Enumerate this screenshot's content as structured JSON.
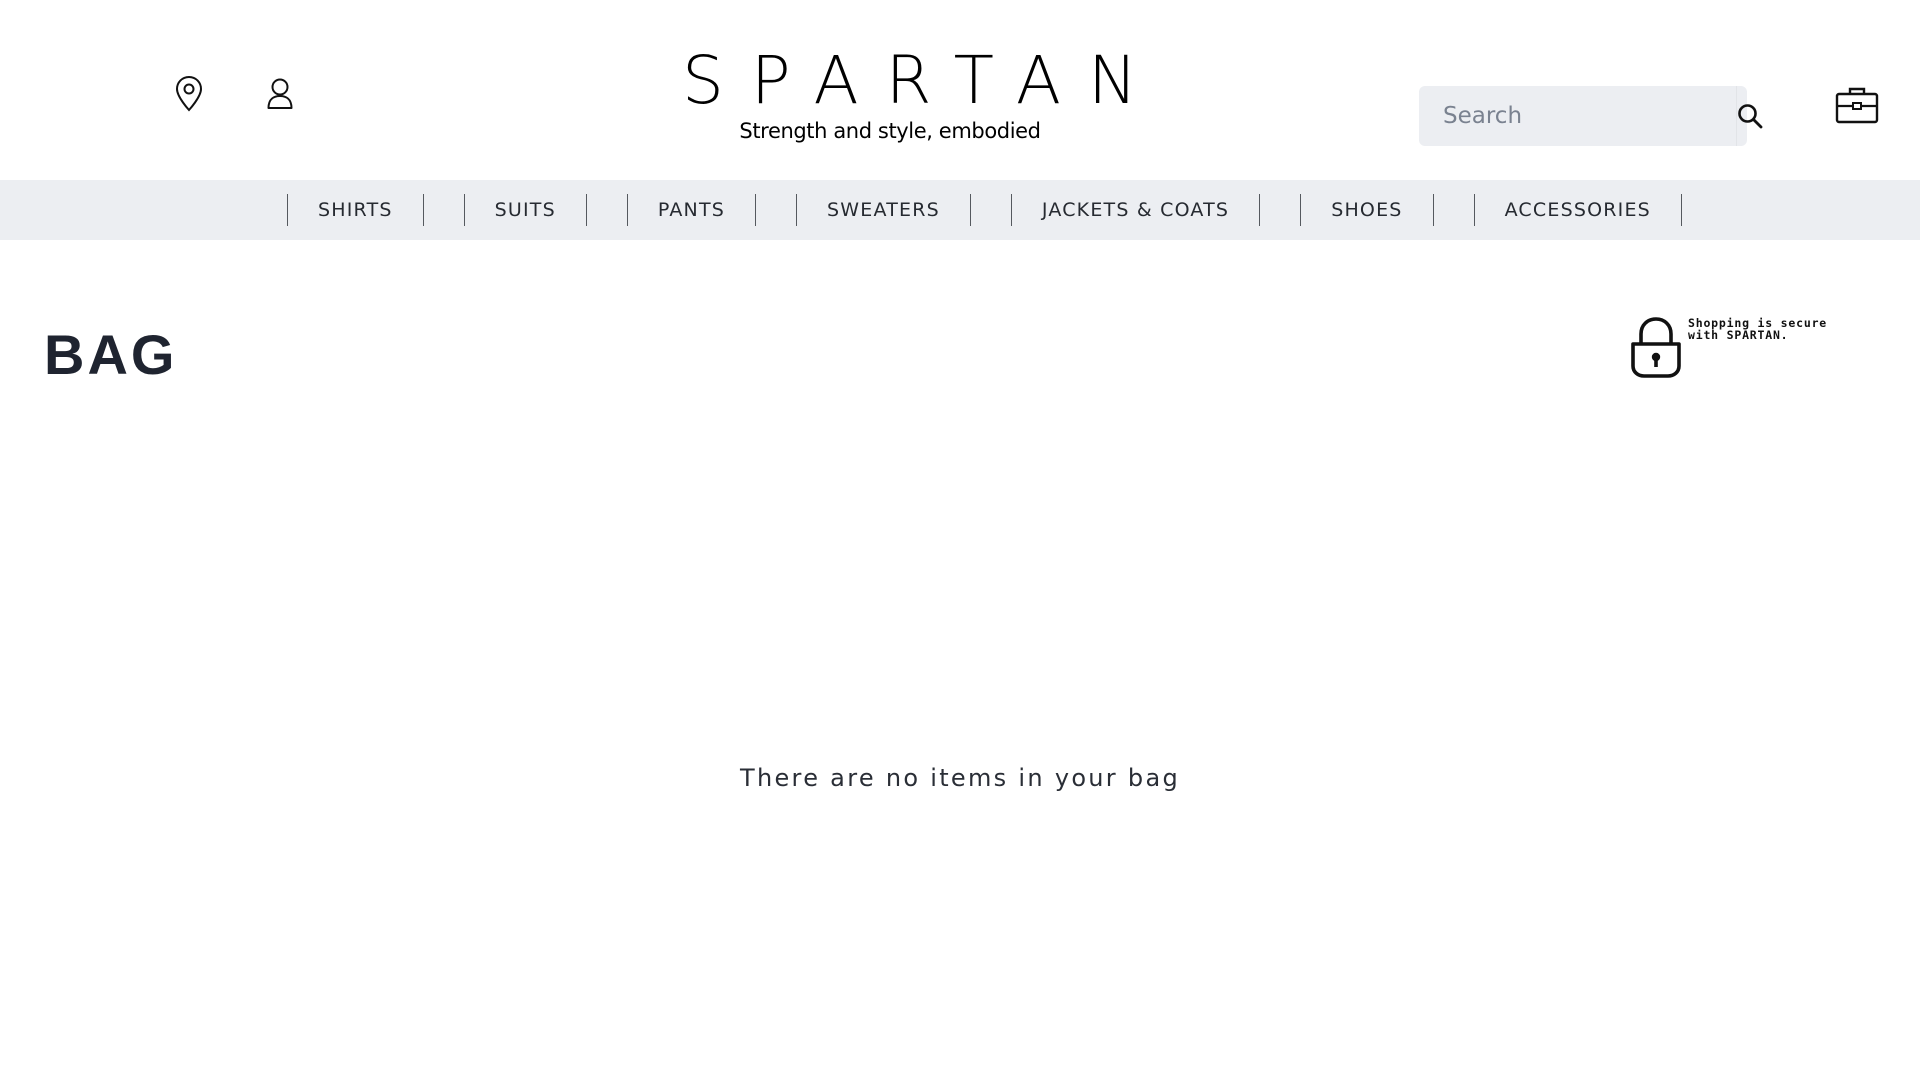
{
  "header": {
    "brand": "SPARTAN",
    "tagline": "Strength and style, embodied",
    "icons": {
      "location": "map-pin-icon",
      "account": "user-icon",
      "search": "search-icon",
      "bag": "briefcase-icon"
    },
    "search": {
      "placeholder": "Search",
      "value": ""
    }
  },
  "nav": {
    "items": [
      "SHIRTS",
      "SUITS",
      "PANTS",
      "SWEATERS",
      "JACKETS & COATS",
      "SHOES",
      "ACCESSORIES"
    ]
  },
  "main": {
    "title": "BAG",
    "secure_note": "Shopping is secure with SPARTAN.",
    "secure_icon": "lock-icon",
    "empty_message": "There are no items in your bag"
  },
  "colors": {
    "nav_background": "#eceef2",
    "search_background": "#eceef2",
    "text": "#1f2430"
  }
}
